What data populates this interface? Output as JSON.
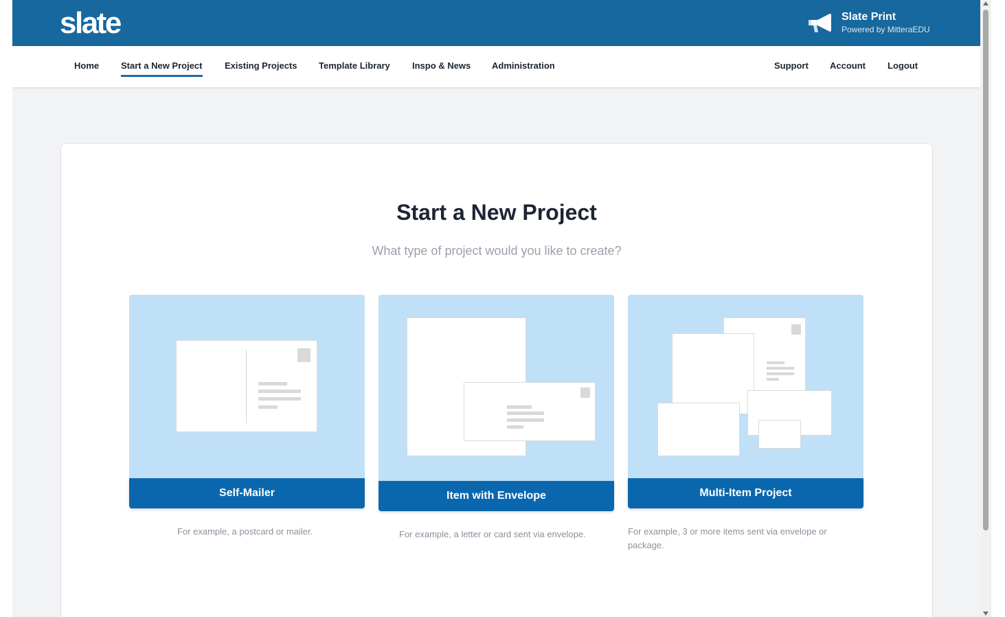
{
  "header": {
    "logo": "slate",
    "brand_title": "Slate Print",
    "brand_subtitle": "Powered by MitteraEDU",
    "brand_icon": "megaphone-icon",
    "bg_color": "#16689e"
  },
  "nav": {
    "left": [
      "Home",
      "Start a New Project",
      "Existing Projects",
      "Template Library",
      "Inspo & News",
      "Administration"
    ],
    "right": [
      "Support",
      "Account",
      "Logout"
    ],
    "active": "Start a New Project"
  },
  "main": {
    "title": "Start a New Project",
    "subtitle": "What type of project would you like to create?",
    "options": [
      {
        "label": "Self-Mailer",
        "description": "For example, a postcard or mailer."
      },
      {
        "label": "Item with Envelope",
        "description": "For example, a letter or card sent via envelope."
      },
      {
        "label": "Multi-Item Project",
        "description": "For example, 3 or more items sent via envelope or package."
      }
    ]
  },
  "colors": {
    "accent": "#0b67ad",
    "illustration_bg": "#bfe0f7"
  }
}
